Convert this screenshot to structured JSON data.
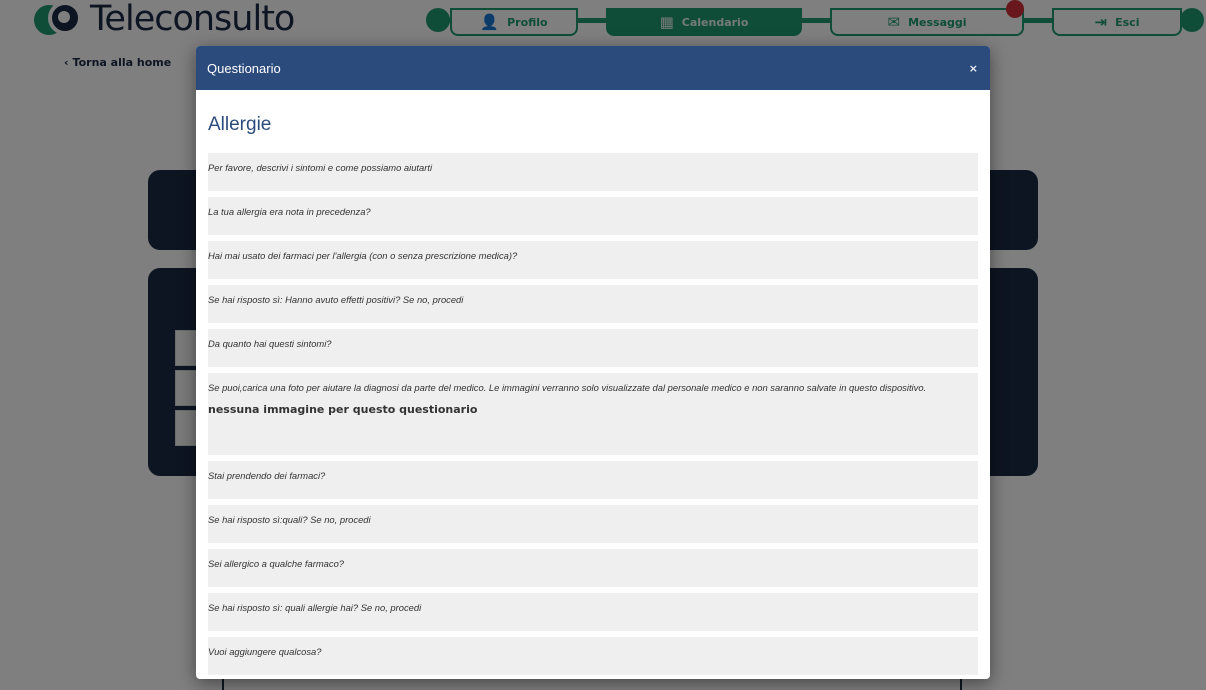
{
  "app": {
    "logo_text": "Teleconsulto"
  },
  "nav": {
    "items": [
      {
        "label": "Profilo",
        "icon": "user-icon"
      },
      {
        "label": "Calendario",
        "icon": "calendar-icon"
      },
      {
        "label": "Messaggi",
        "icon": "envelope-icon"
      },
      {
        "label": "Esci",
        "icon": "logout-icon"
      }
    ],
    "accent_color": "#1e9a73",
    "badge_color": "#d0303a"
  },
  "back_link": "Torna alla home",
  "modal": {
    "title": "Questionario",
    "close_label": "×",
    "header_color": "#2c4b7d",
    "section_title": "Allergie",
    "questions": [
      "Per favore, descrivi i sintomi e come possiamo aiutarti",
      "La tua allergia era nota in precedenza?",
      "Hai mai usato dei farmaci per l'allergia (con o senza prescrizione medica)?",
      "Se hai risposto sì: Hanno avuto effetti positivi? Se no, procedi",
      "Da quanto hai questi sintomi?",
      "Se puoi,carica una foto per aiutare la diagnosi da parte del medico. Le immagini verranno solo visualizzate dal personale medico e non saranno salvate in questo dispositivo.",
      "Stai prendendo dei farmaci?",
      "Se hai risposto sì:quali? Se no, procedi",
      "Sei allergico a qualche farmaco?",
      "Se hai risposto sì: quali allergie hai? Se no, procedi",
      "Vuoi aggiungere qualcosa?"
    ],
    "no_image_text": "nessuna immagine per questo questionario"
  }
}
